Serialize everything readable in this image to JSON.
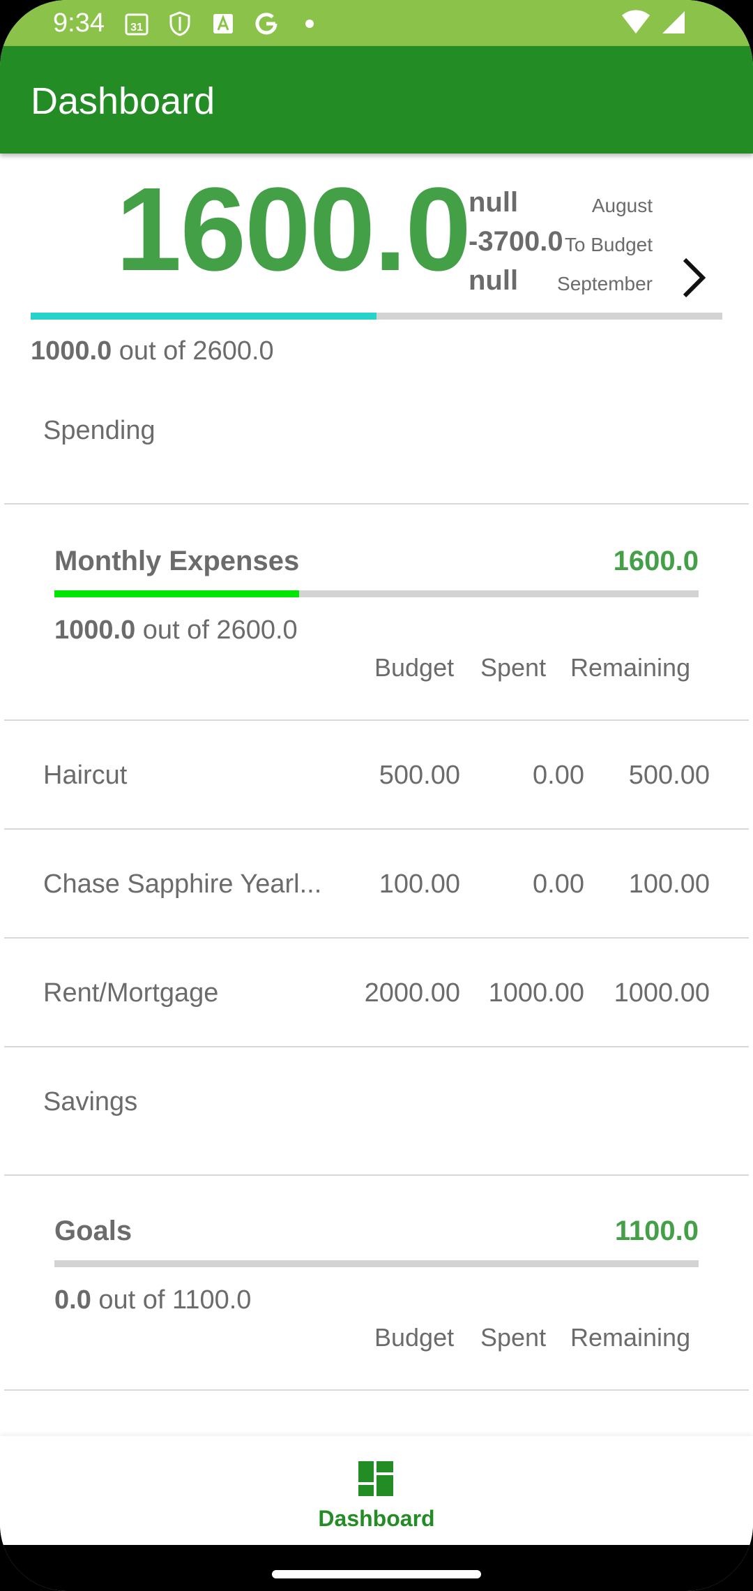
{
  "status_bar": {
    "time": "9:34",
    "icons": [
      "calendar-icon",
      "shield-icon",
      "font-icon",
      "google-icon",
      "dot-icon",
      "wifi-icon",
      "signal-icon"
    ]
  },
  "app_bar": {
    "title": "Dashboard"
  },
  "summary": {
    "big_value": "1600.0",
    "side_top": "null",
    "side_mid": "-3700.0",
    "side_bottom": "null",
    "month_prev": "August",
    "month_label": "To Budget",
    "month_next": "September",
    "progress_fraction": 0.5,
    "spent_value": "1000.0",
    "out_of_text": "out of 2600.0",
    "progress_color": "#26d3c8"
  },
  "spending": {
    "section_label": "Spending",
    "group": {
      "title": "Monthly Expenses",
      "amount": "1600.0",
      "progress_fraction": 0.38,
      "progress_color": "#00e600",
      "spent_value": "1000.0",
      "out_of_text": "out of 2600.0",
      "columns": [
        "Budget",
        "Spent",
        "Remaining"
      ]
    },
    "rows": [
      {
        "name": "Haircut",
        "budget": "500.00",
        "spent": "0.00",
        "remaining": "500.00"
      },
      {
        "name": "Chase Sapphire Yearl...",
        "budget": "100.00",
        "spent": "0.00",
        "remaining": "100.00"
      },
      {
        "name": "Rent/Mortgage",
        "budget": "2000.00",
        "spent": "1000.00",
        "remaining": "1000.00"
      }
    ]
  },
  "savings": {
    "section_label": "Savings",
    "group": {
      "title": "Goals",
      "amount": "1100.0",
      "progress_fraction": 0.0,
      "spent_value": "0.0",
      "out_of_text": "out of 1100.0",
      "columns": [
        "Budget",
        "Spent",
        "Remaining"
      ]
    }
  },
  "bottom_nav": {
    "label": "Dashboard",
    "icon": "dashboard-icon",
    "color": "#248c24"
  }
}
